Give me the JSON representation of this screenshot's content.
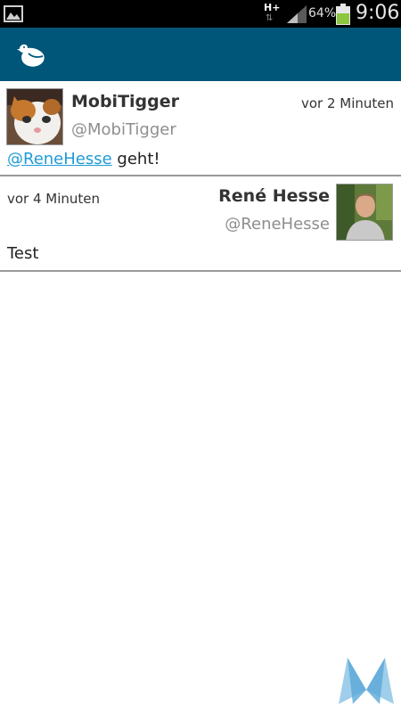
{
  "status_bar": {
    "network_type": "H+",
    "network_arrows": "⇅",
    "battery_percent": "64%",
    "battery_level": 0.64,
    "time": "9:06"
  },
  "app_bar": {
    "logo_icon": "bird-icon",
    "color": "#005679"
  },
  "tweets": [
    {
      "name": "MobiTigger",
      "handle": "@MobiTigger",
      "time": "vor 2 Minuten",
      "mention": "@ReneHesse",
      "text": " geht!",
      "avatar": "cat-avatar"
    },
    {
      "name": "René Hesse",
      "handle": "@ReneHesse",
      "time": "vor 4 Minuten",
      "text": "Test",
      "avatar": "person-avatar"
    }
  ],
  "colors": {
    "link": "#1f9bd6",
    "divider": "#9a9a9a",
    "battery_fill": "#8cc63f"
  },
  "watermark_icon": "mobi-logo-icon"
}
